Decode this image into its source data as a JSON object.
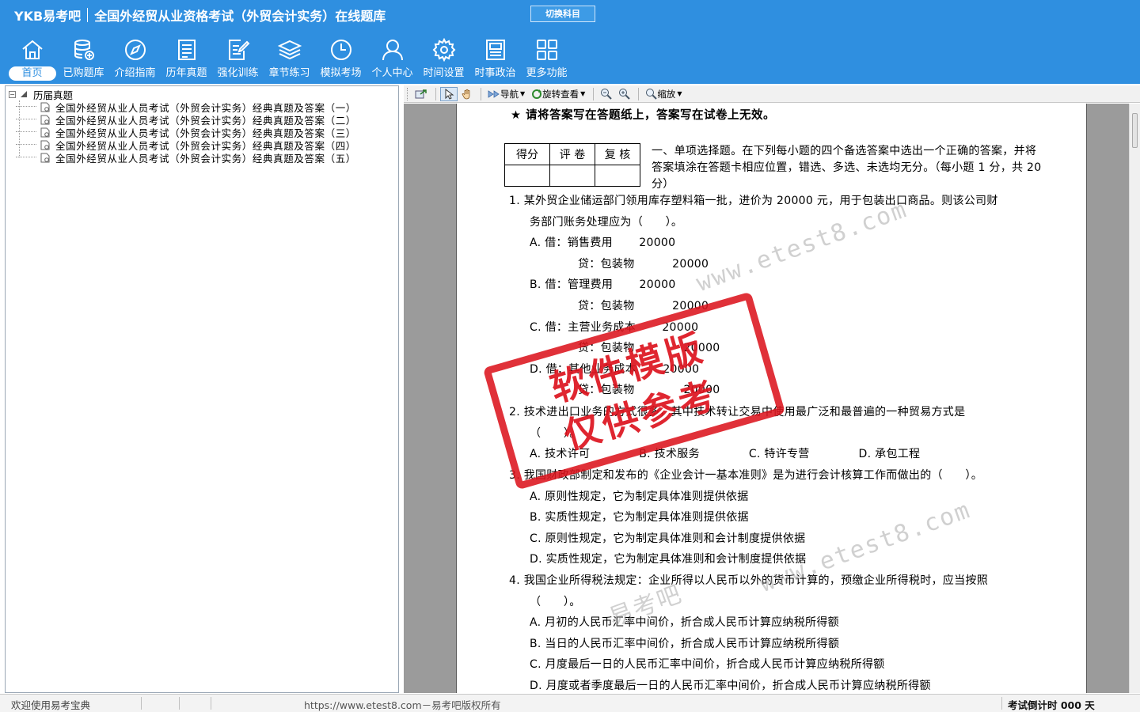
{
  "header": {
    "logo": "YKB易考吧",
    "title": "全国外经贸从业资格考试（外贸会计实务）在线题库",
    "switch_button": "切换科目"
  },
  "nav": [
    {
      "label": "首页",
      "icon": "home-icon"
    },
    {
      "label": "已购题库",
      "icon": "database-icon"
    },
    {
      "label": "介绍指南",
      "icon": "compass-icon"
    },
    {
      "label": "历年真题",
      "icon": "list-document-icon"
    },
    {
      "label": "强化训练",
      "icon": "edit-document-icon"
    },
    {
      "label": "章节练习",
      "icon": "layers-icon"
    },
    {
      "label": "模拟考场",
      "icon": "clock-icon"
    },
    {
      "label": "个人中心",
      "icon": "user-icon"
    },
    {
      "label": "时间设置",
      "icon": "gear-icon"
    },
    {
      "label": "时事政治",
      "icon": "newspaper-icon"
    },
    {
      "label": "更多功能",
      "icon": "grid-icon"
    }
  ],
  "tree": {
    "root": "历届真题",
    "items": [
      "全国外经贸从业人员考试（外贸会计实务）经典真题及答案（一）",
      "全国外经贸从业人员考试（外贸会计实务）经典真题及答案（二）",
      "全国外经贸从业人员考试（外贸会计实务）经典真题及答案（三）",
      "全国外经贸从业人员考试（外贸会计实务）经典真题及答案（四）",
      "全国外经贸从业人员考试（外贸会计实务）经典真题及答案（五）"
    ]
  },
  "toolbar": {
    "navigate": "导航",
    "rotate_view": "旋转查看",
    "zoom": "缩放"
  },
  "document": {
    "notice": "★ 请将答案写在答题纸上，答案写在试卷上无效。",
    "score_table": [
      "得分",
      "评 卷",
      "复 核"
    ],
    "section_intro": "一、单项选择题。在下列每小题的四个备选答案中选出一个正确的答案，并将答案填涂在答题卡相应位置，错选、多选、未选均无分。（每小题 1 分，共 20 分）",
    "q1_l1": "1. 某外贸企业储运部门领用库存塑料箱一批，进价为 20000 元，用于包装出口商品。则该公司财",
    "q1_l2": "务部门账务处理应为（　　）。",
    "q1_a1": "A. 借：销售费用　　 20000",
    "q1_a2": "贷：包装物　　　 20000",
    "q1_b1": "B. 借：管理费用　　 20000",
    "q1_b2": "贷：包装物　　　 20000",
    "q1_c1": "C. 借：主营业务成本　　 20000",
    "q1_c2": "贷：包装物　　　　 20000",
    "q1_d1": "D. 借：其他业务成本　　 20000",
    "q1_d2": "贷：包装物　　　　 20000",
    "q2_l1": "2. 技术进出口业务的方式很多，其中技术转让交易中使用最广泛和最普遍的一种贸易方式是",
    "q2_l2": "（　　）。",
    "q2_opts": "A. 技术许可　　　　 B. 技术服务　　　　 C. 特许专营　　　　 D. 承包工程",
    "q3_l1": "3. 我国财政部制定和发布的《企业会计一基本准则》是为进行会计核算工作而做出的（　　）。",
    "q3_a": "A. 原则性规定，它为制定具体准则提供依据",
    "q3_b": "B. 实质性规定，它为制定具体准则提供依据",
    "q3_c": "C. 原则性规定，它为制定具体准则和会计制度提供依据",
    "q3_d": "D. 实质性规定，它为制定具体准则和会计制度提供依据",
    "q4_l1": "4. 我国企业所得税法规定：企业所得以人民币以外的货币计算的，预缴企业所得税时，应当按照",
    "q4_l2": "（　　）。",
    "q4_a": "A. 月初的人民币汇率中间价，折合成人民币计算应纳税所得额",
    "q4_b": "B. 当日的人民币汇率中间价，折合成人民币计算应纳税所得额",
    "q4_c": "C. 月度最后一日的人民币汇率中间价，折合成人民币计算应纳税所得额",
    "q4_d": "D. 月度或者季度最后一日的人民币汇率中间价，折合成人民币计算应纳税所得额",
    "watermark_url": "www.etest8.com",
    "watermark_url2": "www.etest8.com",
    "watermark_cn": "易考吧",
    "stamp_line1": "软件模版",
    "stamp_line2": "仅供参考"
  },
  "status": {
    "welcome": "欢迎使用易考宝典",
    "copyright": "https://www.etest8.com－易考吧版权所有",
    "countdown": "考试倒计时 000 天"
  },
  "colors": {
    "header_bg": "#2f8fe0",
    "stamp_red": "#dc141e"
  }
}
